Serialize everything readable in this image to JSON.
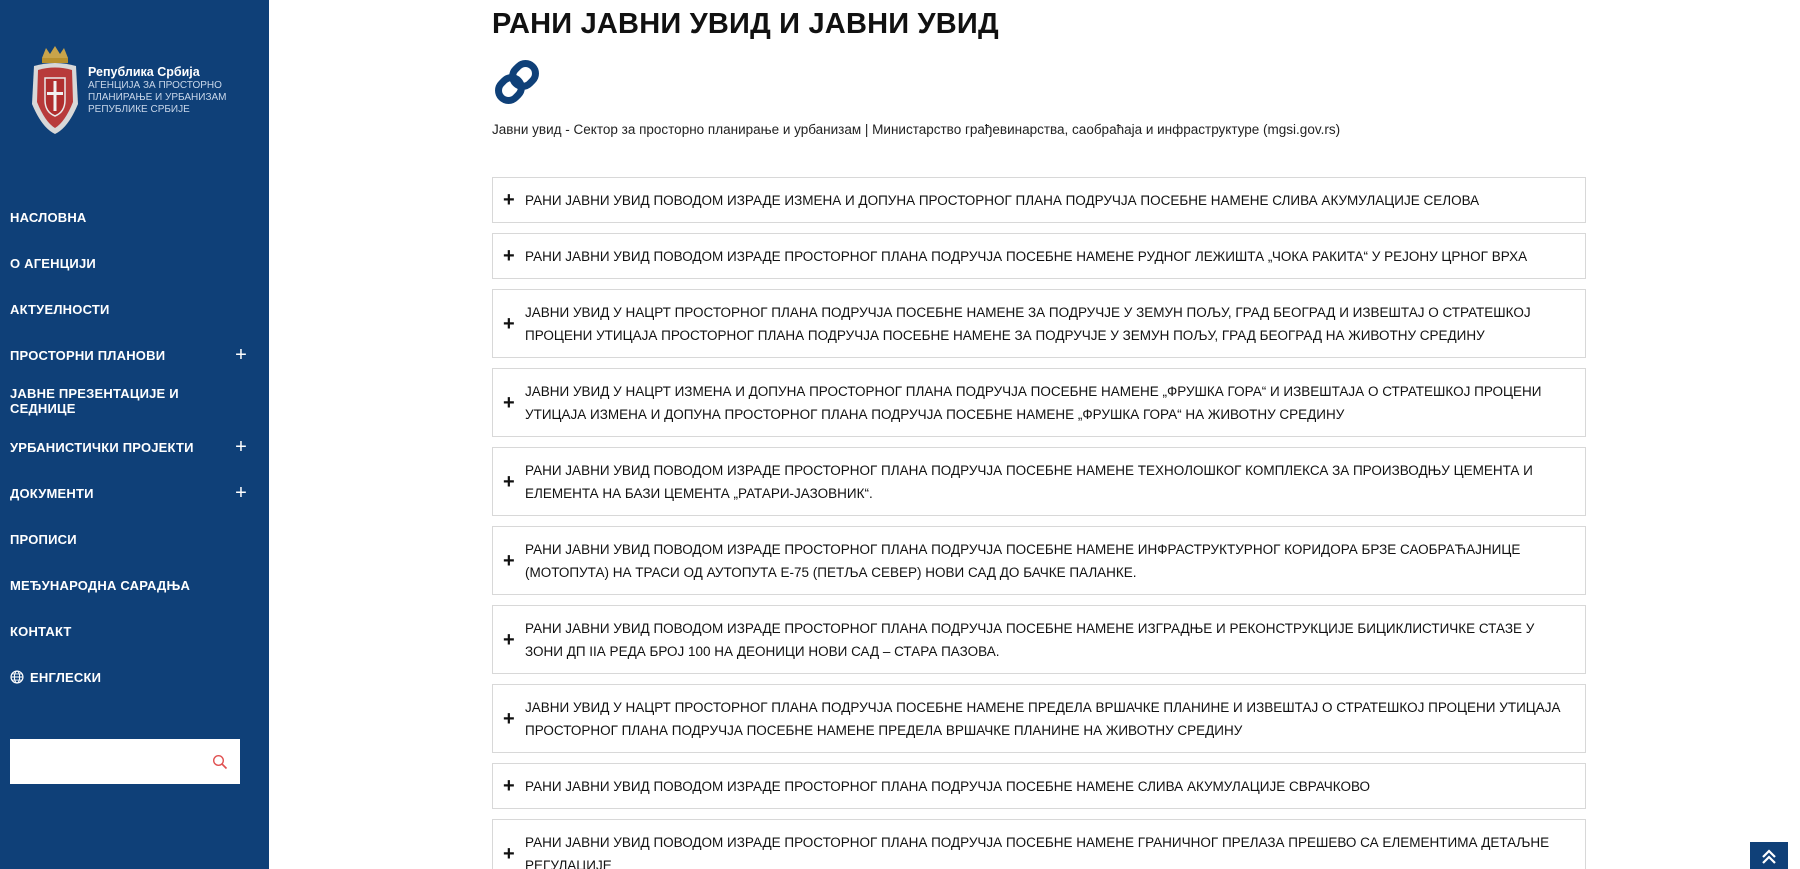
{
  "logo": {
    "title": "Република Србија",
    "subtitle_lines": [
      "АГЕНЦИЈА ЗА ПРОСТОРНО",
      "ПЛАНИРАЊЕ И УРБАНИЗАМ",
      "РЕПУБЛИКЕ СРБИЈЕ"
    ],
    "icon": "coat-of-arms"
  },
  "nav": {
    "items": [
      {
        "label": "НАСЛОВНА",
        "expandable": false
      },
      {
        "label": "О АГЕНЦИЈИ",
        "expandable": false
      },
      {
        "label": "АКТУЕЛНОСТИ",
        "expandable": false
      },
      {
        "label": "ПРОСТОРНИ ПЛАНОВИ",
        "expandable": true
      },
      {
        "label": "ЈАВНЕ ПРЕЗЕНТАЦИЈЕ И СЕДНИЦЕ",
        "expandable": false
      },
      {
        "label": "УРБАНИСТИЧКИ ПРОЈЕКТИ",
        "expandable": true
      },
      {
        "label": "ДОКУМЕНТИ",
        "expandable": true
      },
      {
        "label": "ПРОПИСИ",
        "expandable": false
      },
      {
        "label": "МЕЂУНАРОДНА САРАДЊА",
        "expandable": false
      },
      {
        "label": "КОНТАКТ",
        "expandable": false
      },
      {
        "label": "ЕНГЛЕСКИ",
        "expandable": false,
        "icon": "globe-icon"
      }
    ],
    "expand_symbol": "+"
  },
  "search": {
    "value": "",
    "placeholder": "",
    "icon": "search-icon"
  },
  "main": {
    "title": "РАНИ ЈАВНИ УВИД И ЈАВНИ УВИД",
    "link_icon": "link-icon",
    "source_link": "Јавни увид - Сектор за просторно планирање и урбанизам | Министарство грађевинарства, саобраћаја и инфраструктуре (mgsi.gov.rs)",
    "accordion_symbol": "+",
    "accordion": [
      {
        "label": "РАНИ ЈАВНИ УВИД ПОВОДОМ ИЗРАДЕ ИЗМЕНА И ДОПУНА ПРОСТОРНОГ ПЛАНА ПОДРУЧЈА ПОСЕБНЕ НАМЕНЕ СЛИВА АКУМУЛАЦИЈЕ СЕЛОВА",
        "lines": 1
      },
      {
        "label": "РАНИ ЈАВНИ УВИД ПОВОДОМ ИЗРАДЕ ПРОСТОРНОГ ПЛАНА ПОДРУЧЈА ПОСЕБНЕ НАМЕНЕ РУДНОГ ЛЕЖИШТА „ЧОКА РАКИТА“ У РЕЈОНУ ЦРНОГ ВРХА",
        "lines": 1
      },
      {
        "label": "ЈАВНИ УВИД У НАЦРТ ПРОСТОРНОГ ПЛАНА ПОДРУЧЈА ПОСЕБНЕ НАМЕНЕ ЗА ПОДРУЧЈЕ У ЗЕМУН ПОЉУ, ГРАД БЕОГРАД И ИЗВЕШТАЈ О СТРАТЕШКОЈ ПРОЦЕНИ УТИЦАЈА ПРОСТОРНОГ ПЛАНА ПОДРУЧЈА ПОСЕБНЕ НАМЕНЕ ЗА ПОДРУЧЈЕ У ЗЕМУН ПОЉУ, ГРАД БЕОГРАД НА ЖИВОТНУ СРЕДИНУ",
        "lines": 2
      },
      {
        "label": "ЈАВНИ УВИД У НАЦРТ ИЗМЕНА И ДОПУНА ПРОСТОРНОГ ПЛАНА ПОДРУЧЈА ПОСЕБНЕ НАМЕНЕ „ФРУШКА ГОРА“ И ИЗВЕШТАЈА О СТРАТЕШКОЈ ПРОЦЕНИ УТИЦАЈА ИЗМЕНА И ДОПУНА ПРОСТОРНОГ ПЛАНА ПОДРУЧЈА ПОСЕБНЕ НАМЕНЕ „ФРУШКА ГОРА“ НА ЖИВОТНУ СРЕДИНУ",
        "lines": 2
      },
      {
        "label": "РАНИ ЈАВНИ УВИД ПОВОДОМ ИЗРАДЕ ПРОСТОРНОГ ПЛАНА ПОДРУЧЈА ПОСЕБНЕ НАМЕНЕ ТЕХНОЛОШКОГ КОМПЛЕКСА ЗА ПРОИЗВОДЊУ ЦЕМЕНТА И ЕЛЕМЕНТА НА БАЗИ ЦЕМЕНТА „РАТАРИ-ЈАЗОВНИК“.",
        "lines": 2
      },
      {
        "label": "РАНИ ЈАВНИ УВИД ПОВОДОМ ИЗРАДЕ ПРОСТОРНОГ ПЛАНА ПОДРУЧЈА ПОСЕБНЕ НАМЕНЕ ИНФРАСТРУКТУРНОГ КОРИДОРА БРЗЕ САОБРАЋАЈНИЦЕ (МОТОПУТА) НА ТРАСИ ОД АУТОПУТА Е-75 (ПЕТЉА СЕВЕР) НОВИ САД ДО БАЧКЕ ПАЛАНКЕ.",
        "lines": 2
      },
      {
        "label": "РАНИ ЈАВНИ УВИД ПОВОДОМ ИЗРАДЕ ПРОСТОРНОГ ПЛАНА ПОДРУЧЈА ПОСЕБНЕ НАМЕНЕ ИЗГРАДЊЕ И РЕКОНСТРУКЦИЈЕ БИЦИКЛИСТИЧКЕ СТАЗЕ У ЗОНИ ДП IIА РЕДА БРОЈ 100 НА ДЕОНИЦИ НОВИ САД – СТАРА ПАЗОВА.",
        "lines": 2
      },
      {
        "label": "ЈАВНИ УВИД У НАЦРТ ПРОСТОРНОГ ПЛАНА ПОДРУЧЈА ПОСЕБНЕ НАМЕНЕ ПРЕДЕЛА ВРШАЧКЕ ПЛАНИНЕ И ИЗВЕШТАЈ О СТРАТЕШКОЈ ПРОЦЕНИ УТИЦАЈА ПРОСТОРНОГ ПЛАНА ПОДРУЧЈА ПОСЕБНЕ НАМЕНЕ ПРЕДЕЛА ВРШАЧКЕ ПЛАНИНЕ НА ЖИВОТНУ СРЕДИНУ",
        "lines": 2
      },
      {
        "label": "РАНИ ЈАВНИ УВИД ПОВОДОМ ИЗРАДЕ ПРОСТОРНОГ ПЛАНА ПОДРУЧЈА ПОСЕБНЕ НАМЕНЕ СЛИВА АКУМУЛАЦИЈЕ СВРАЧКОВО",
        "lines": 1
      },
      {
        "label": "РАНИ ЈАВНИ УВИД ПОВОДОМ ИЗРАДЕ ПРОСТОРНОГ ПЛАНА ПОДРУЧЈА ПОСЕБНЕ НАМЕНЕ ГРАНИЧНОГ ПРЕЛАЗА ПРЕШЕВО СА ЕЛЕМЕНТИМА ДЕТАЉНЕ РЕГУЛАЦИЈЕ",
        "lines": 2
      }
    ]
  },
  "back_to_top": {
    "icon": "chevrons-up-icon"
  },
  "colors": {
    "sidebar": "#0f4078",
    "link_icon": "#0f4078",
    "search_icon": "#e05050"
  }
}
